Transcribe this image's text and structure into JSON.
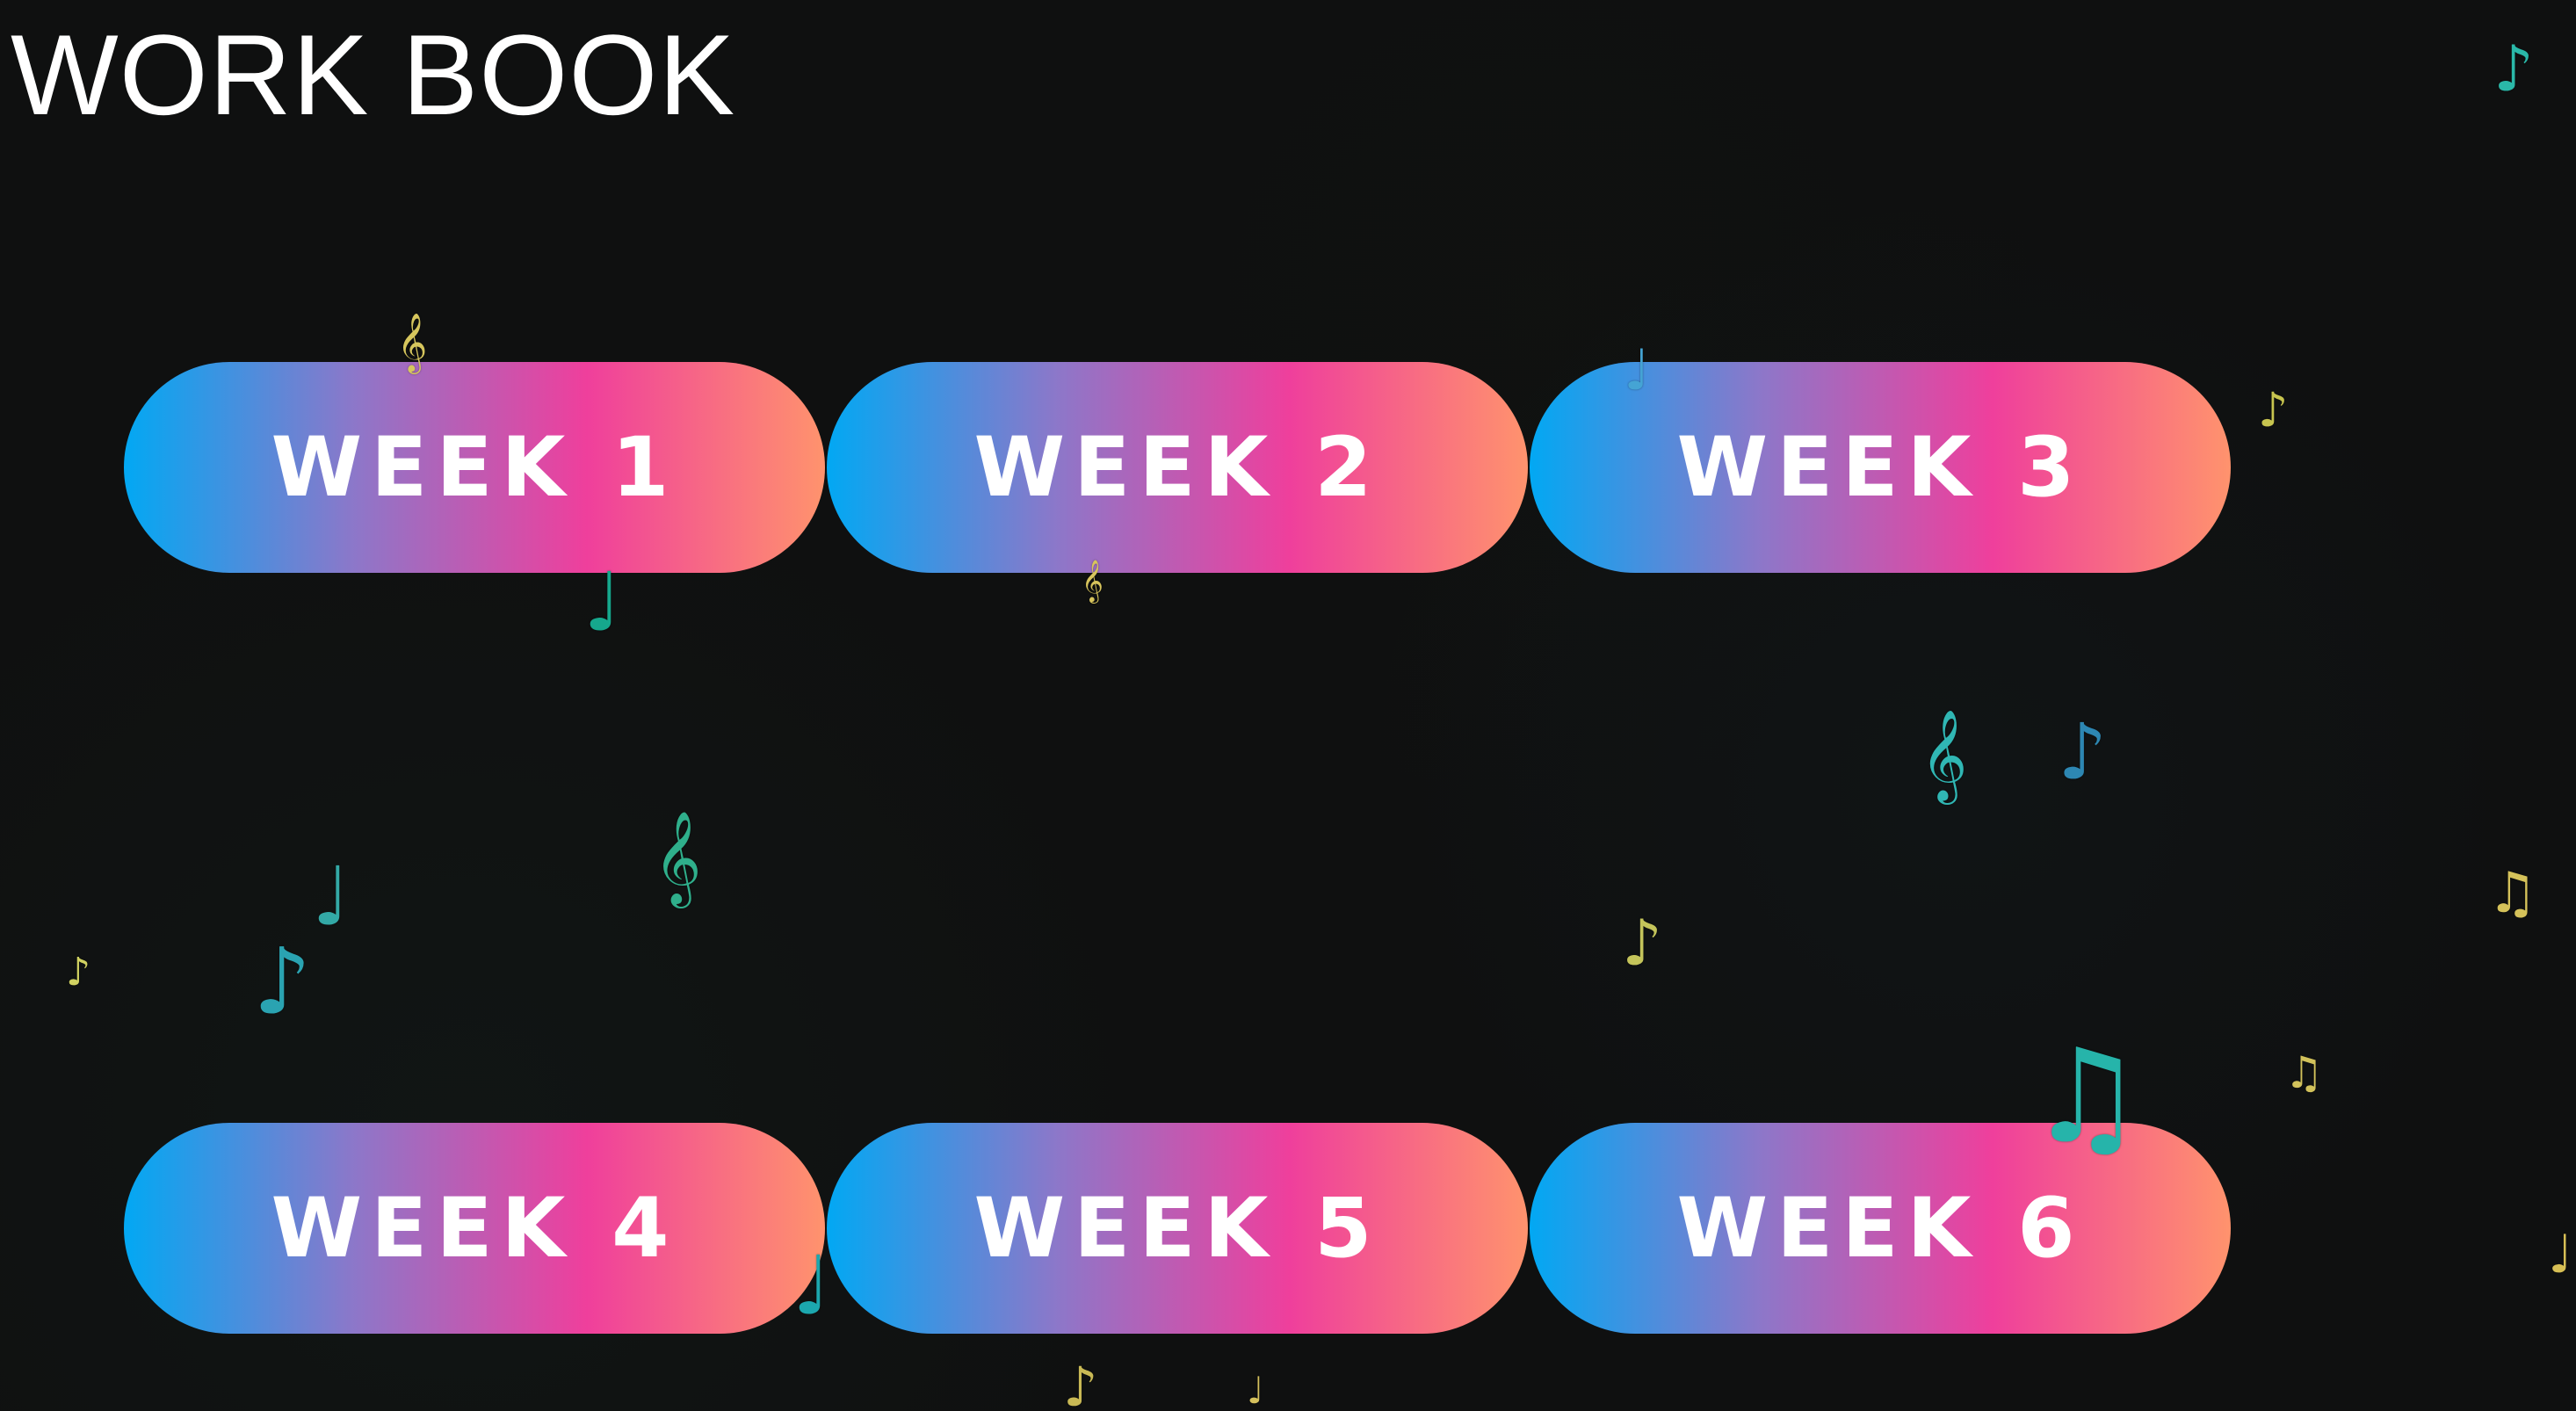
{
  "page": {
    "title": "WORK BOOK"
  },
  "buttons": [
    {
      "label": "WEEK 1"
    },
    {
      "label": "WEEK 2"
    },
    {
      "label": "WEEK 3"
    },
    {
      "label": "WEEK 4"
    },
    {
      "label": "WEEK 5"
    },
    {
      "label": "WEEK 6"
    }
  ],
  "decorations": {
    "notes": [
      {
        "icon": "music-note-icon",
        "glyph": "♪",
        "color": "#2ab8a8"
      },
      {
        "icon": "treble-clef-icon",
        "glyph": "𝄞",
        "color": "#d6c65d"
      },
      {
        "icon": "music-note-icon",
        "glyph": "♩",
        "color": "#45a4d4"
      },
      {
        "icon": "music-note-icon",
        "glyph": "♪",
        "color": "#c7c44f"
      },
      {
        "icon": "music-note-icon",
        "glyph": "♩",
        "color": "#16a88d"
      },
      {
        "icon": "treble-clef-icon",
        "glyph": "𝄞",
        "color": "#d7c45c"
      },
      {
        "icon": "treble-clef-icon",
        "glyph": "𝄞",
        "color": "#30b7b4"
      },
      {
        "icon": "music-note-icon",
        "glyph": "♪",
        "color": "#2d87b3"
      },
      {
        "icon": "treble-clef-icon",
        "glyph": "𝄞",
        "color": "#2faf8b"
      },
      {
        "icon": "music-note-icon",
        "glyph": "♩",
        "color": "#33a9a6"
      },
      {
        "icon": "music-note-icon",
        "glyph": "♪",
        "color": "#d1d261"
      },
      {
        "icon": "music-note-icon",
        "glyph": "♪",
        "color": "#2aa3b1"
      },
      {
        "icon": "music-note-icon",
        "glyph": "♪",
        "color": "#c4c45a"
      },
      {
        "icon": "beamed-notes-icon",
        "glyph": "♫",
        "color": "#d5c25a"
      },
      {
        "icon": "beamed-notes-icon",
        "glyph": "♫",
        "color": "#d2c25b"
      },
      {
        "icon": "beamed-notes-icon",
        "glyph": "♫",
        "color": "#26b4aa"
      },
      {
        "icon": "music-note-icon",
        "glyph": "♩",
        "color": "#1ca7ae"
      },
      {
        "icon": "music-note-icon",
        "glyph": "♪",
        "color": "#c9b955"
      },
      {
        "icon": "music-note-icon",
        "glyph": "♩",
        "color": "#d5c15d"
      },
      {
        "icon": "music-note-icon",
        "glyph": "♩",
        "color": "#d7bf55"
      }
    ]
  },
  "colors": {
    "background": "#0f1010",
    "title": "#ffffff",
    "button_gradient": [
      "#02a8f3",
      "#8d77c9",
      "#ef3f9c",
      "#ff936d"
    ],
    "button_text": "#ffffff"
  }
}
